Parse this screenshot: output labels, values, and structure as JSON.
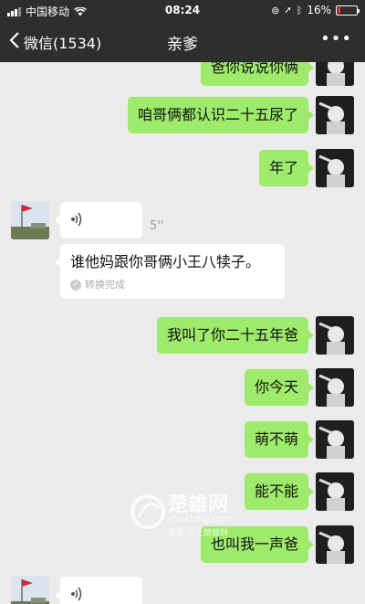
{
  "status": {
    "carrier": "中国移动",
    "time": "08:24",
    "battery": "16%",
    "battery_level": 0.16
  },
  "nav": {
    "back_label": "微信(1534)",
    "title": "亲爹",
    "more": "•••"
  },
  "messages": [
    {
      "side": "me",
      "text": "爸你说说你俩"
    },
    {
      "side": "me",
      "text": "咱哥俩都认识二十五尿了"
    },
    {
      "side": "me",
      "text": "年了"
    },
    {
      "side": "other",
      "type": "voice",
      "duration": "5''"
    },
    {
      "side": "other",
      "type": "converted",
      "text": "谁他妈跟你哥俩小王八犊子。",
      "note": "转换完成"
    },
    {
      "side": "me",
      "text": "我叫了你二十五年爸"
    },
    {
      "side": "me",
      "text": "你今天"
    },
    {
      "side": "me",
      "text": "萌不萌"
    },
    {
      "side": "me",
      "text": "能不能"
    },
    {
      "side": "me",
      "text": "也叫我一声爸"
    }
  ],
  "watermark": {
    "brand": "楚雄网",
    "domain": "chuxiong.com",
    "slogan": "楚雄·网上楚雄网"
  }
}
